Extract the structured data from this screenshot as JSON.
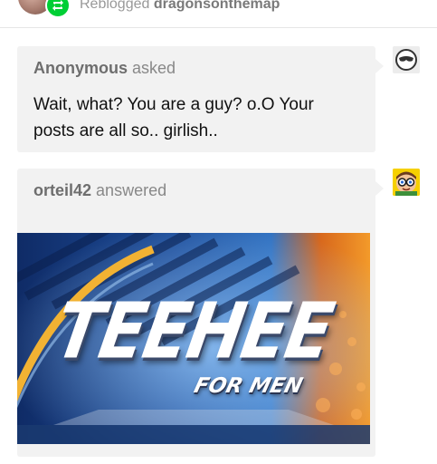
{
  "reblog": {
    "prefix": "Reblogged",
    "blog_name": "dragonsonthemap",
    "badge_icon": "reblog-icon",
    "badge_color": "#00cf35"
  },
  "ask": {
    "asker": "Anonymous",
    "verb": "asked",
    "question": "Wait, what? You are a guy? o.O Your posts are all so.. girlish..",
    "avatar_icon": "anonymous-avatar-icon"
  },
  "answer": {
    "answerer": "orteil42",
    "verb": "answered",
    "avatar_icon": "orteil42-avatar",
    "image": {
      "title": "TEEHEE",
      "subtitle": "FOR MEN"
    }
  },
  "colors": {
    "bubble": "#f2f2f2",
    "text": "#222222",
    "muted": "#888888"
  }
}
